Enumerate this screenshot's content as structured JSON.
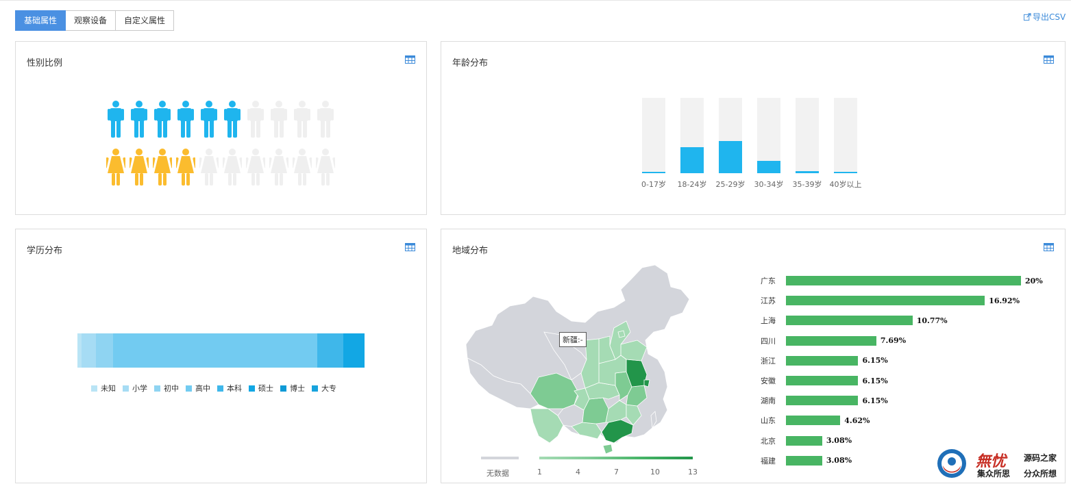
{
  "tabs": [
    {
      "label": "基础属性",
      "active": true
    },
    {
      "label": "观察设备",
      "active": false
    },
    {
      "label": "自定义属性",
      "active": false
    }
  ],
  "export_label": "导出CSV",
  "panels": {
    "gender": {
      "title": "性别比例",
      "male_filled": 6,
      "male_total": 10,
      "female_filled": 4,
      "female_total": 10,
      "male_color": "#1fb5ee",
      "female_color": "#fbbc2e",
      "empty_color": "#efefef"
    },
    "age": {
      "title": "年龄分布",
      "bar_color": "#1fb5ee",
      "track_color": "#f2f2f2"
    },
    "education": {
      "title": "学历分布"
    },
    "region": {
      "title": "地域分布",
      "tooltip": "新疆:-",
      "legend_nodata": "无数据",
      "legend_ticks": [
        "1",
        "4",
        "7",
        "10",
        "13"
      ],
      "bar_color": "#48b563"
    }
  },
  "chart_data": [
    {
      "type": "bar",
      "categories": [
        "0-17岁",
        "18-24岁",
        "25-29岁",
        "30-34岁",
        "35-39岁",
        "40岁以上"
      ],
      "values": [
        2,
        35,
        43,
        16,
        3,
        2
      ],
      "ylim": [
        0,
        100
      ]
    },
    {
      "type": "bar",
      "stacked": true,
      "categories": [
        "未知",
        "小学",
        "初中",
        "高中",
        "本科",
        "硕士",
        "博士",
        "大专"
      ],
      "values": [
        1.5,
        5,
        6,
        71,
        9,
        7.5,
        0,
        0
      ],
      "colors": [
        "#b9e4f5",
        "#a6dcf4",
        "#8fd4f2",
        "#72cbf1",
        "#3fb7ea",
        "#12a7e4",
        "#0e9ad6",
        "#17a3dd"
      ]
    },
    {
      "type": "bar",
      "orientation": "horizontal",
      "categories": [
        "广东",
        "江苏",
        "上海",
        "四川",
        "浙江",
        "安徽",
        "湖南",
        "山东",
        "北京",
        "福建"
      ],
      "values": [
        20,
        16.92,
        10.77,
        7.69,
        6.15,
        6.15,
        6.15,
        4.62,
        3.08,
        3.08
      ],
      "labels": [
        "20%",
        "16.92%",
        "10.77%",
        "7.69%",
        "6.15%",
        "6.15%",
        "6.15%",
        "4.62%",
        "3.08%",
        "3.08%"
      ],
      "xlim": [
        0,
        20
      ]
    }
  ],
  "watermark": {
    "brand": "無忧",
    "line1": "源码之家",
    "line2a": "集众所思",
    "line2b": "分众所想"
  }
}
